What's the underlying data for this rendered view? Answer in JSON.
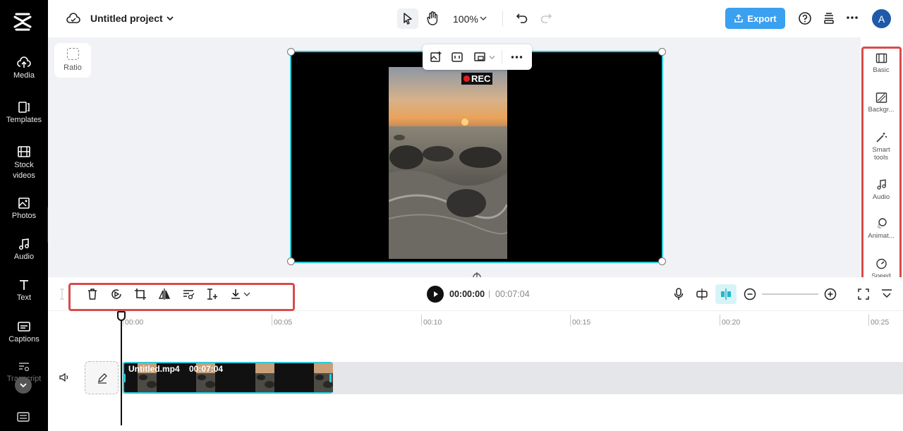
{
  "sidebar": {
    "items": [
      {
        "label": "Media"
      },
      {
        "label": "Templates"
      },
      {
        "label": "Stock videos"
      },
      {
        "label": "Photos"
      },
      {
        "label": "Audio"
      },
      {
        "label": "Text"
      },
      {
        "label": "Captions"
      },
      {
        "label": "Transcript"
      }
    ]
  },
  "header": {
    "project_title": "Untitled project",
    "zoom": "100%",
    "export_label": "Export",
    "avatar_letter": "A"
  },
  "canvas": {
    "ratio_label": "Ratio",
    "rec_label": "REC"
  },
  "right_panel": {
    "items": [
      {
        "label": "Basic"
      },
      {
        "label": "Backgr..."
      },
      {
        "label": "Smart tools"
      },
      {
        "label": "Audio"
      },
      {
        "label": "Animat..."
      },
      {
        "label": "Speed"
      }
    ]
  },
  "timeline": {
    "current_time": "00:00:00",
    "separator": "|",
    "total_time": "00:07:04",
    "ruler": [
      "00:00",
      "00:05",
      "00:10",
      "00:15",
      "00:20",
      "00:25"
    ],
    "clip_name": "Untitled.mp4",
    "clip_duration": "00:07:04"
  },
  "colors": {
    "accent": "#2bc9d9",
    "export_button": "#3aa0f0",
    "highlight_box": "#d94b4b",
    "avatar": "#1e5aa8"
  }
}
